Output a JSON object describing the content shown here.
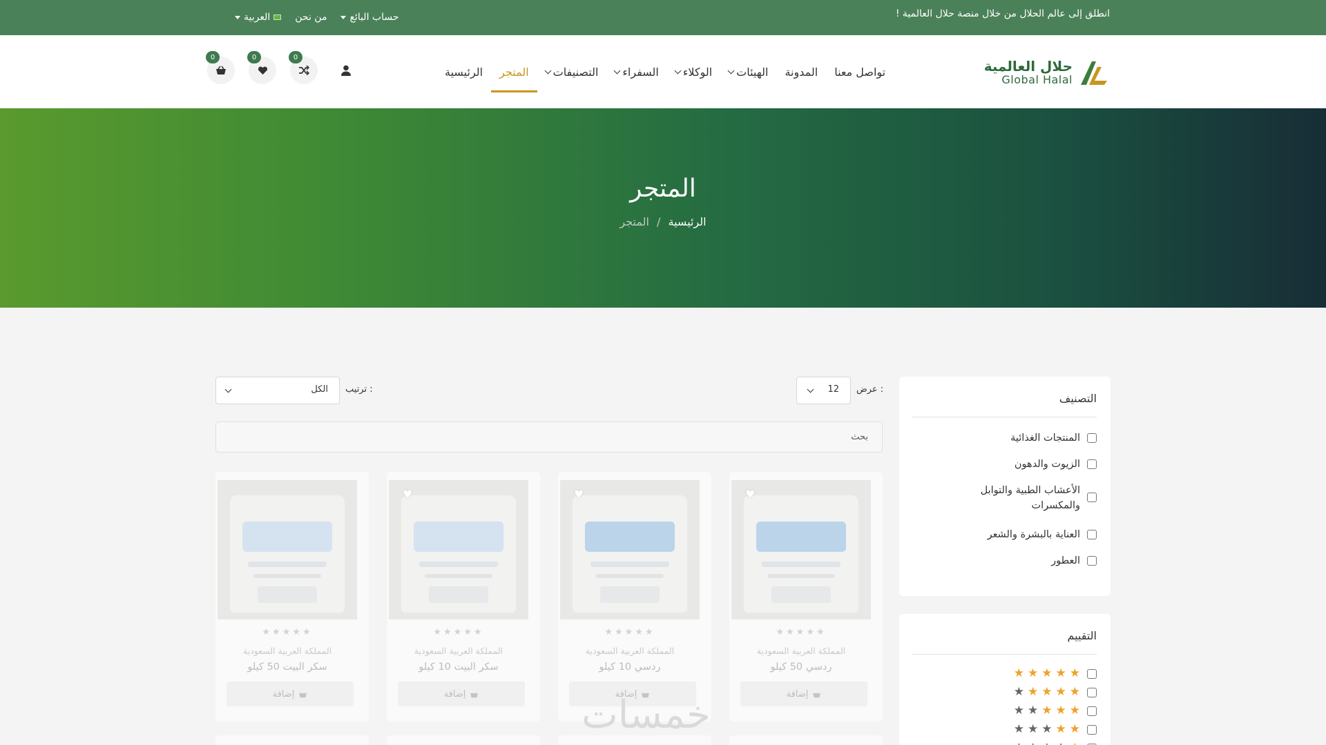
{
  "topbar": {
    "tagline": "انطلق إلى عالم الحلال من خلال منصة حلال العالمية !",
    "language": "العربية",
    "about": "من نحن",
    "seller": "حساب البائع"
  },
  "logo": {
    "ar": "حلال العالمية",
    "en": "Global Halal"
  },
  "nav": [
    {
      "label": "الرئيسية",
      "active": false,
      "dropdown": false
    },
    {
      "label": "المتجر",
      "active": true,
      "dropdown": false
    },
    {
      "label": "التصنيفات",
      "active": false,
      "dropdown": true
    },
    {
      "label": "السفراء",
      "active": false,
      "dropdown": true
    },
    {
      "label": "الوكلاء",
      "active": false,
      "dropdown": true
    },
    {
      "label": "الهيئات",
      "active": false,
      "dropdown": true
    },
    {
      "label": "المدونة",
      "active": false,
      "dropdown": false
    },
    {
      "label": "تواصل معنا",
      "active": false,
      "dropdown": false
    }
  ],
  "header_icons": {
    "compare_count": "0",
    "wishlist_count": "0",
    "cart_count": "0"
  },
  "hero": {
    "title": "المتجر",
    "breadcrumb_home": "الرئيسية",
    "breadcrumb_sep": "/",
    "breadcrumb_current": "المتجر"
  },
  "filters": {
    "category_title": "التصنيف",
    "categories": [
      "المنتجات الغذائية",
      "الزيوت والدهون",
      "الأعشاب الطبية والتوابل والمكسرات",
      "العناية بالبشرة والشعر",
      "العطور"
    ],
    "rating_title": "التقييم",
    "ratings": [
      5,
      4,
      3,
      2,
      1
    ]
  },
  "toolbar": {
    "show_label": "عرض :",
    "show_value": "12",
    "sort_label": "ترتيب :",
    "sort_value": "الكل",
    "search_placeholder": "بحث"
  },
  "products": [
    {
      "name": "ردسي 50 كيلو",
      "country": "المملكة العربية السعودية",
      "add": "إضافة",
      "style": "red"
    },
    {
      "name": "ردسي 10 كيلو",
      "country": "المملكة العربية السعودية",
      "add": "إضافة",
      "style": "red"
    },
    {
      "name": "سكر البيت 10 كيلو",
      "country": "المملكة العربية السعودية",
      "add": "إضافة",
      "style": "beit"
    },
    {
      "name": "سكر البيت 50 كيلو",
      "country": "المملكة العربية السعودية",
      "add": "إضافة",
      "style": "beit"
    }
  ],
  "watermark": "خمسات",
  "colors": {
    "topbar": "#4a8159",
    "accent": "#c8961f",
    "star": "#f0a12a",
    "badge": "#3e7a4e"
  }
}
